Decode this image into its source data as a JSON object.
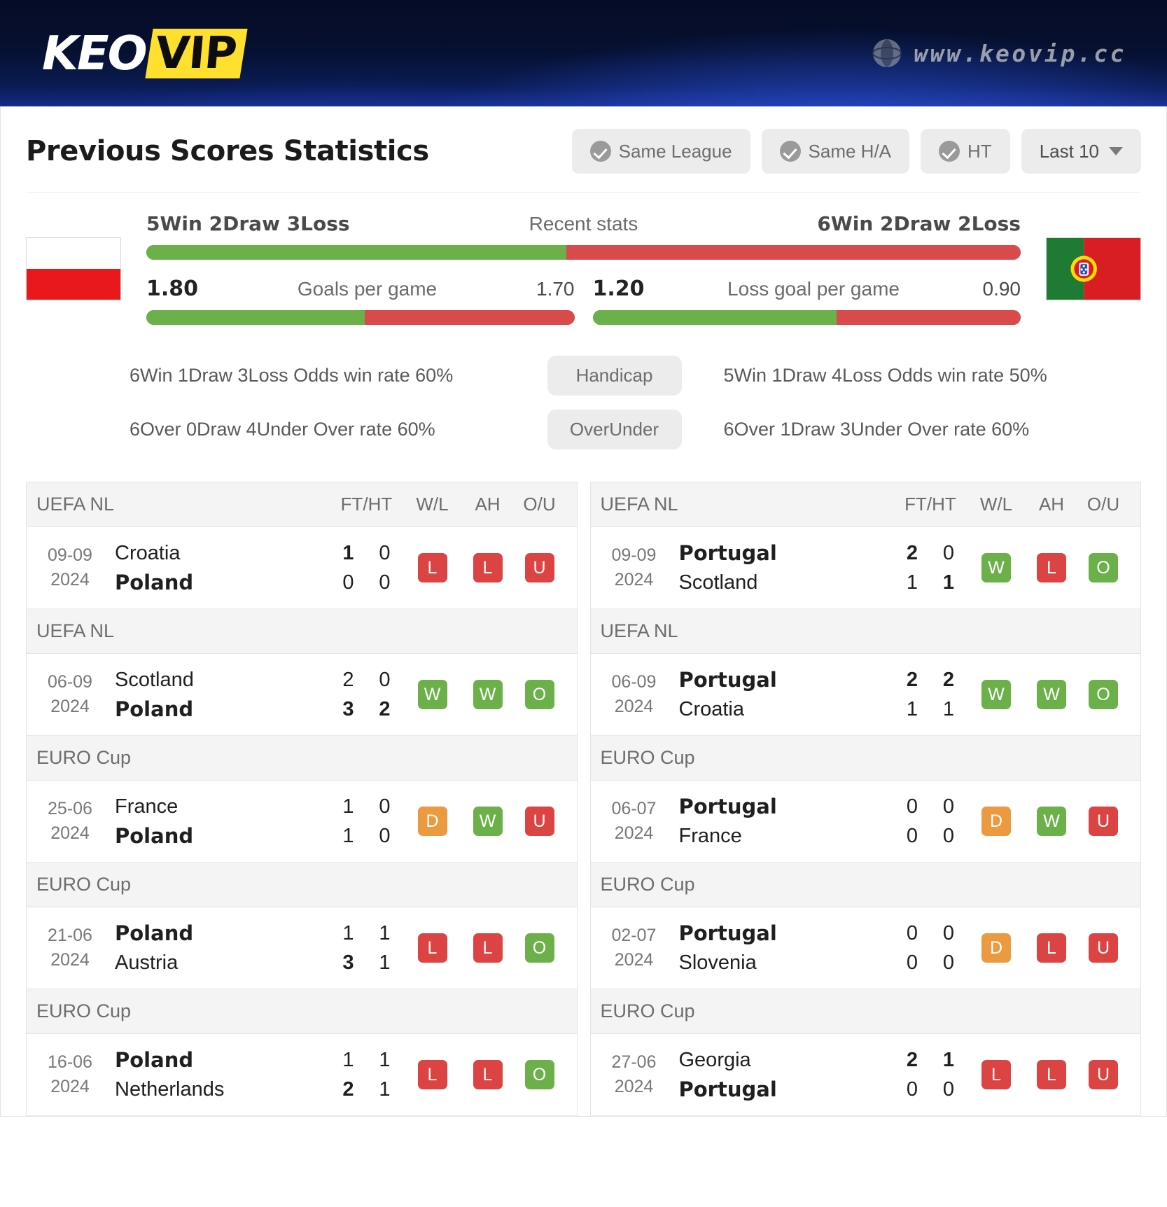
{
  "brand": {
    "logo_main": "KEO",
    "logo_accent": "VIP",
    "site_url": "www.keovip.cc",
    "globe_icon": "globe-icon",
    "banner_color": "#0b1c55",
    "accent_color": "#ffe02e"
  },
  "header": {
    "title": "Previous Scores Statistics",
    "filters": [
      {
        "label": "Same League",
        "icon": "check-circle-icon",
        "checked": true
      },
      {
        "label": "Same H/A",
        "icon": "check-circle-icon",
        "checked": true
      },
      {
        "label": "HT",
        "icon": "check-circle-icon",
        "checked": true
      }
    ],
    "range_select": {
      "label": "Last 10",
      "icon": "chevron-down-icon"
    }
  },
  "comparison": {
    "home_flag": "poland-flag",
    "away_flag": "portugal-flag",
    "recent_label": "Recent stats",
    "home_recent": "5Win 2Draw 3Loss",
    "away_recent": "6Win 2Draw 2Loss",
    "recent_bar": {
      "green_pct": 48,
      "red_pct": 52,
      "green_color": "#6cb04a",
      "red_color": "#d94a4a"
    },
    "stats": [
      {
        "name": "Goals per game",
        "home_value": "1.80",
        "away_value": "1.70",
        "bar": {
          "green_pct": 51,
          "red_pct": 49
        }
      },
      {
        "name": "Loss goal per game",
        "home_value": "1.20",
        "away_value": "0.90",
        "bar": {
          "green_pct": 57,
          "red_pct": 43
        }
      }
    ],
    "odds_rows": [
      {
        "pill": "Handicap",
        "left": "6Win 1Draw 3Loss Odds win rate 60%",
        "right": "5Win 1Draw 4Loss Odds win rate 50%"
      },
      {
        "pill": "OverUnder",
        "left": "6Over 0Draw 4Under Over rate 60%",
        "right": "6Over 1Draw 3Under Over rate 60%"
      }
    ]
  },
  "table_columns": {
    "ft_ht": "FT/HT",
    "wl": "W/L",
    "ah": "AH",
    "ou": "O/U"
  },
  "left_table": [
    {
      "league": "UEFA NL",
      "date_day": "09-09",
      "date_year": "2024",
      "home": "Croatia",
      "home_bold": false,
      "away": "Poland",
      "away_bold": true,
      "home_ft": "1",
      "home_ft_bold": true,
      "home_ht": "0",
      "home_ht_bold": false,
      "away_ft": "0",
      "away_ft_bold": false,
      "away_ht": "0",
      "away_ht_bold": false,
      "wl": "L",
      "ah": "L",
      "ou": "U"
    },
    {
      "league": "UEFA NL",
      "date_day": "06-09",
      "date_year": "2024",
      "home": "Scotland",
      "home_bold": false,
      "away": "Poland",
      "away_bold": true,
      "home_ft": "2",
      "home_ft_bold": false,
      "home_ht": "0",
      "home_ht_bold": false,
      "away_ft": "3",
      "away_ft_bold": true,
      "away_ht": "2",
      "away_ht_bold": true,
      "wl": "W",
      "ah": "W",
      "ou": "O"
    },
    {
      "league": "EURO Cup",
      "date_day": "25-06",
      "date_year": "2024",
      "home": "France",
      "home_bold": false,
      "away": "Poland",
      "away_bold": true,
      "home_ft": "1",
      "home_ft_bold": false,
      "home_ht": "0",
      "home_ht_bold": false,
      "away_ft": "1",
      "away_ft_bold": false,
      "away_ht": "0",
      "away_ht_bold": false,
      "wl": "D",
      "ah": "W",
      "ou": "U"
    },
    {
      "league": "EURO Cup",
      "date_day": "21-06",
      "date_year": "2024",
      "home": "Poland",
      "home_bold": true,
      "away": "Austria",
      "away_bold": false,
      "home_ft": "1",
      "home_ft_bold": false,
      "home_ht": "1",
      "home_ht_bold": false,
      "away_ft": "3",
      "away_ft_bold": true,
      "away_ht": "1",
      "away_ht_bold": false,
      "wl": "L",
      "ah": "L",
      "ou": "O"
    },
    {
      "league": "EURO Cup",
      "date_day": "16-06",
      "date_year": "2024",
      "home": "Poland",
      "home_bold": true,
      "away": "Netherlands",
      "away_bold": false,
      "home_ft": "1",
      "home_ft_bold": false,
      "home_ht": "1",
      "home_ht_bold": false,
      "away_ft": "2",
      "away_ft_bold": true,
      "away_ht": "1",
      "away_ht_bold": false,
      "wl": "L",
      "ah": "L",
      "ou": "O"
    }
  ],
  "right_table": [
    {
      "league": "UEFA NL",
      "date_day": "09-09",
      "date_year": "2024",
      "home": "Portugal",
      "home_bold": true,
      "away": "Scotland",
      "away_bold": false,
      "home_ft": "2",
      "home_ft_bold": true,
      "home_ht": "0",
      "home_ht_bold": false,
      "away_ft": "1",
      "away_ft_bold": false,
      "away_ht": "1",
      "away_ht_bold": true,
      "wl": "W",
      "ah": "L",
      "ou": "O"
    },
    {
      "league": "UEFA NL",
      "date_day": "06-09",
      "date_year": "2024",
      "home": "Portugal",
      "home_bold": true,
      "away": "Croatia",
      "away_bold": false,
      "home_ft": "2",
      "home_ft_bold": true,
      "home_ht": "2",
      "home_ht_bold": true,
      "away_ft": "1",
      "away_ft_bold": false,
      "away_ht": "1",
      "away_ht_bold": false,
      "wl": "W",
      "ah": "W",
      "ou": "O"
    },
    {
      "league": "EURO Cup",
      "date_day": "06-07",
      "date_year": "2024",
      "home": "Portugal",
      "home_bold": true,
      "away": "France",
      "away_bold": false,
      "home_ft": "0",
      "home_ft_bold": false,
      "home_ht": "0",
      "home_ht_bold": false,
      "away_ft": "0",
      "away_ft_bold": false,
      "away_ht": "0",
      "away_ht_bold": false,
      "wl": "D",
      "ah": "W",
      "ou": "U"
    },
    {
      "league": "EURO Cup",
      "date_day": "02-07",
      "date_year": "2024",
      "home": "Portugal",
      "home_bold": true,
      "away": "Slovenia",
      "away_bold": false,
      "home_ft": "0",
      "home_ft_bold": false,
      "home_ht": "0",
      "home_ht_bold": false,
      "away_ft": "0",
      "away_ft_bold": false,
      "away_ht": "0",
      "away_ht_bold": false,
      "wl": "D",
      "ah": "L",
      "ou": "U"
    },
    {
      "league": "EURO Cup",
      "date_day": "27-06",
      "date_year": "2024",
      "home": "Georgia",
      "home_bold": false,
      "away": "Portugal",
      "away_bold": true,
      "home_ft": "2",
      "home_ft_bold": true,
      "home_ht": "1",
      "home_ht_bold": true,
      "away_ft": "0",
      "away_ft_bold": false,
      "away_ht": "0",
      "away_ht_bold": false,
      "wl": "L",
      "ah": "L",
      "ou": "U"
    }
  ]
}
